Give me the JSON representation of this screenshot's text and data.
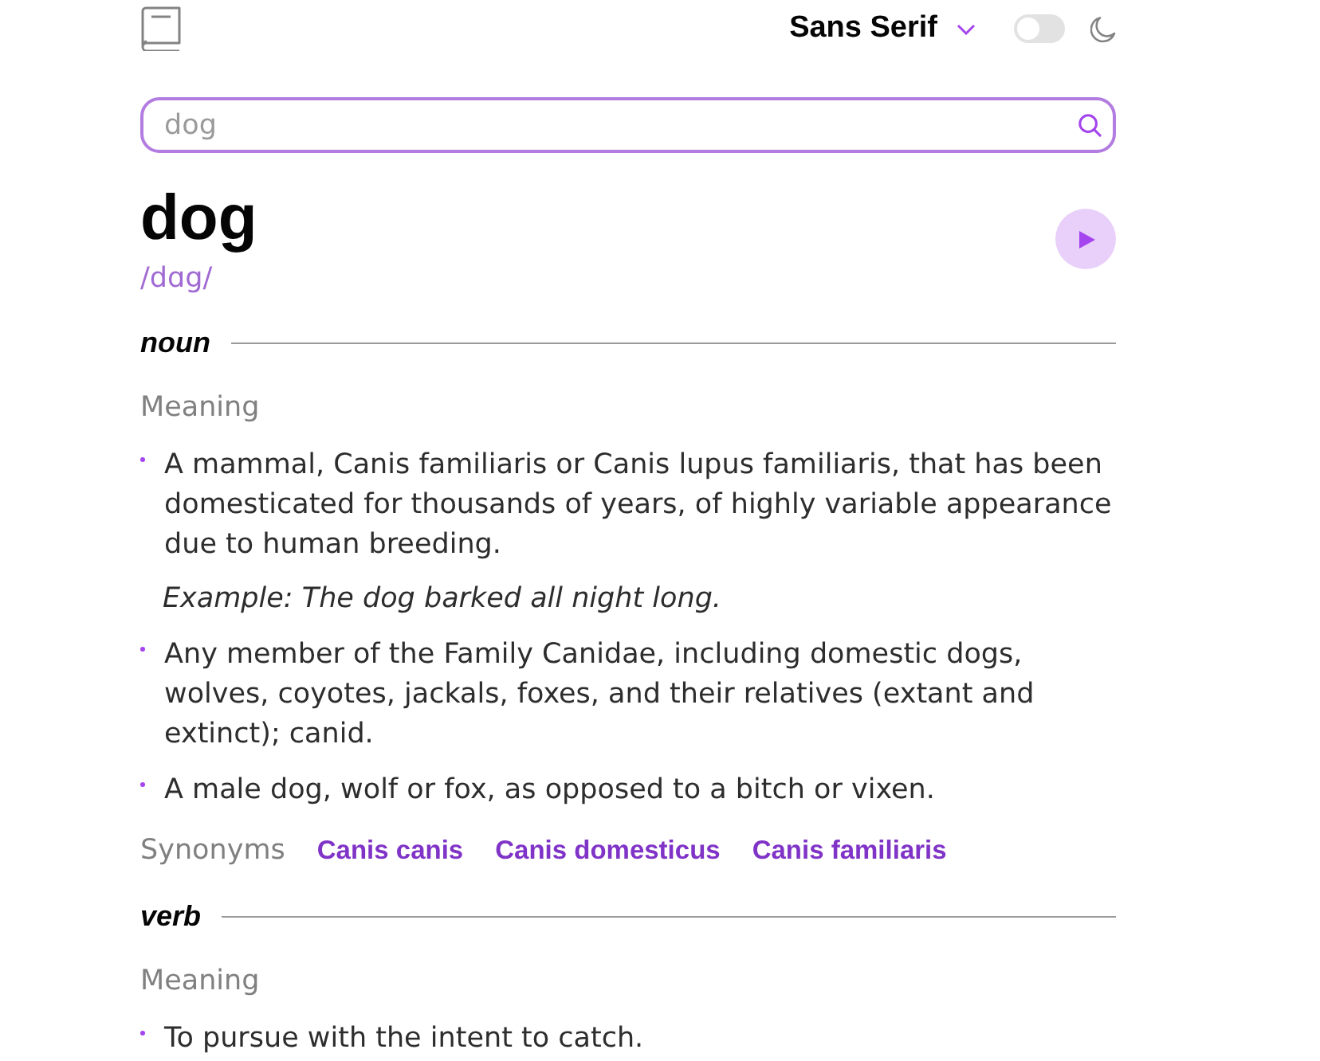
{
  "header": {
    "font_menu": {
      "label": "Sans Serif"
    },
    "dark_mode_toggle": {
      "on": false
    }
  },
  "search": {
    "value": "dog"
  },
  "word": {
    "headword": "dog",
    "phonetic": "/dɑg/"
  },
  "meanings": [
    {
      "part_of_speech": "noun",
      "heading": "Meaning",
      "definitions": [
        {
          "text": "A mammal, Canis familiaris or Canis lupus familiaris, that has been domesticated for thousands of years, of highly variable appearance due to human breeding.",
          "example": "Example: The dog barked all night long."
        },
        {
          "text": "Any member of the Family Canidae, including domestic dogs, wolves, coyotes, jackals, foxes, and their relatives (extant and extinct); canid."
        },
        {
          "text": "A male dog, wolf or fox, as opposed to a bitch or vixen."
        }
      ],
      "synonyms_label": "Synonyms",
      "synonyms": [
        "Canis canis",
        "Canis domesticus",
        "Canis familiaris"
      ]
    },
    {
      "part_of_speech": "verb",
      "heading": "Meaning",
      "definitions": [
        {
          "text": "To pursue with the intent to catch."
        }
      ]
    }
  ]
}
